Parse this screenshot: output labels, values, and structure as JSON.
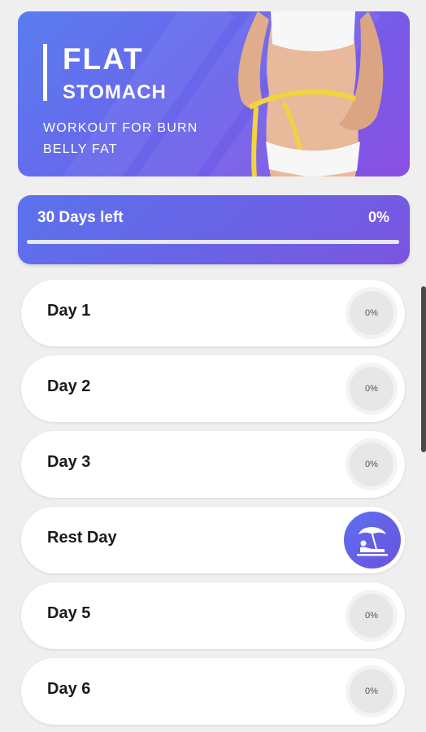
{
  "banner": {
    "title": "FLAT",
    "subtitle": "STOMACH",
    "tagline": "WORKOUT FOR BURN BELLY FAT"
  },
  "progress": {
    "days_left": "30 Days left",
    "percent_label": "0%",
    "fraction": 0
  },
  "days": [
    {
      "label": "Day 1",
      "percent": "0%",
      "type": "workout"
    },
    {
      "label": "Day 2",
      "percent": "0%",
      "type": "workout"
    },
    {
      "label": "Day 3",
      "percent": "0%",
      "type": "workout"
    },
    {
      "label": "Rest Day",
      "icon": "beach-umbrella-icon",
      "type": "rest"
    },
    {
      "label": "Day 5",
      "percent": "0%",
      "type": "workout"
    },
    {
      "label": "Day 6",
      "percent": "0%",
      "type": "workout"
    }
  ],
  "colors": {
    "accent_start": "#5a7df0",
    "accent_end": "#8a4fe3",
    "background": "#efefef"
  }
}
